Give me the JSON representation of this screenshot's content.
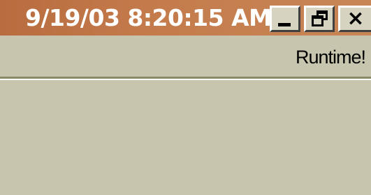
{
  "window": {
    "title": "9/19/03 8:20:15 AM",
    "buttons": {
      "minimize": "_",
      "restore": "restore",
      "close": "×"
    }
  },
  "toolbar": {
    "status_label": "Runtime!"
  },
  "colors": {
    "titlebar": "#b86c3f",
    "window_bg": "#c8c5ae",
    "title_text": "#ffffff"
  }
}
